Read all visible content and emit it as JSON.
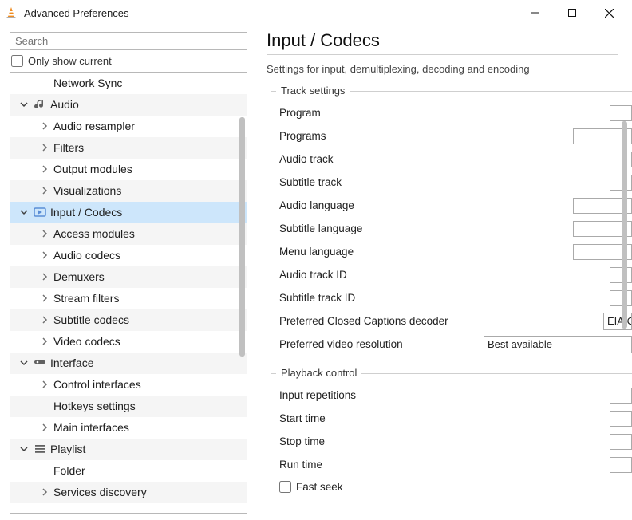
{
  "window": {
    "title": "Advanced Preferences"
  },
  "search": {
    "placeholder": "Search"
  },
  "only_current_label": "Only show current",
  "tree": [
    {
      "label": "Network Sync",
      "level": 2,
      "arrow": "",
      "icon": "",
      "selected": false
    },
    {
      "label": "Audio",
      "level": 1,
      "arrow": "down",
      "icon": "audio",
      "selected": false
    },
    {
      "label": "Audio resampler",
      "level": 2,
      "arrow": "right",
      "icon": "",
      "selected": false
    },
    {
      "label": "Filters",
      "level": 2,
      "arrow": "right",
      "icon": "",
      "selected": false
    },
    {
      "label": "Output modules",
      "level": 2,
      "arrow": "right",
      "icon": "",
      "selected": false
    },
    {
      "label": "Visualizations",
      "level": 2,
      "arrow": "right",
      "icon": "",
      "selected": false
    },
    {
      "label": "Input / Codecs",
      "level": 1,
      "arrow": "down",
      "icon": "codec",
      "selected": true
    },
    {
      "label": "Access modules",
      "level": 2,
      "arrow": "right",
      "icon": "",
      "selected": false
    },
    {
      "label": "Audio codecs",
      "level": 2,
      "arrow": "right",
      "icon": "",
      "selected": false
    },
    {
      "label": "Demuxers",
      "level": 2,
      "arrow": "right",
      "icon": "",
      "selected": false
    },
    {
      "label": "Stream filters",
      "level": 2,
      "arrow": "right",
      "icon": "",
      "selected": false
    },
    {
      "label": "Subtitle codecs",
      "level": 2,
      "arrow": "right",
      "icon": "",
      "selected": false
    },
    {
      "label": "Video codecs",
      "level": 2,
      "arrow": "right",
      "icon": "",
      "selected": false
    },
    {
      "label": "Interface",
      "level": 1,
      "arrow": "down",
      "icon": "iface",
      "selected": false
    },
    {
      "label": "Control interfaces",
      "level": 2,
      "arrow": "right",
      "icon": "",
      "selected": false
    },
    {
      "label": "Hotkeys settings",
      "level": 2,
      "arrow": "",
      "icon": "",
      "selected": false
    },
    {
      "label": "Main interfaces",
      "level": 2,
      "arrow": "right",
      "icon": "",
      "selected": false
    },
    {
      "label": "Playlist",
      "level": 1,
      "arrow": "down",
      "icon": "plist",
      "selected": false
    },
    {
      "label": "Folder",
      "level": 2,
      "arrow": "",
      "icon": "",
      "selected": false
    },
    {
      "label": "Services discovery",
      "level": 2,
      "arrow": "right",
      "icon": "",
      "selected": false
    }
  ],
  "page": {
    "title": "Input / Codecs",
    "subtitle": "Settings for input, demultiplexing, decoding and encoding"
  },
  "groups": {
    "track": {
      "title": "Track settings",
      "rows": {
        "program": "Program",
        "programs": "Programs",
        "audio_track": "Audio track",
        "subtitle_track": "Subtitle track",
        "audio_language": "Audio language",
        "subtitle_language": "Subtitle language",
        "menu_language": "Menu language",
        "audio_track_id": "Audio track ID",
        "subtitle_track_id": "Subtitle track ID",
        "cc_decoder": "Preferred Closed Captions decoder",
        "cc_decoder_value": "EIA/CE",
        "video_res": "Preferred video resolution",
        "video_res_value": "Best available"
      }
    },
    "playback": {
      "title": "Playback control",
      "rows": {
        "input_repetitions": "Input repetitions",
        "start_time": "Start time",
        "stop_time": "Stop time",
        "run_time": "Run time",
        "fast_seek": "Fast seek"
      }
    }
  }
}
